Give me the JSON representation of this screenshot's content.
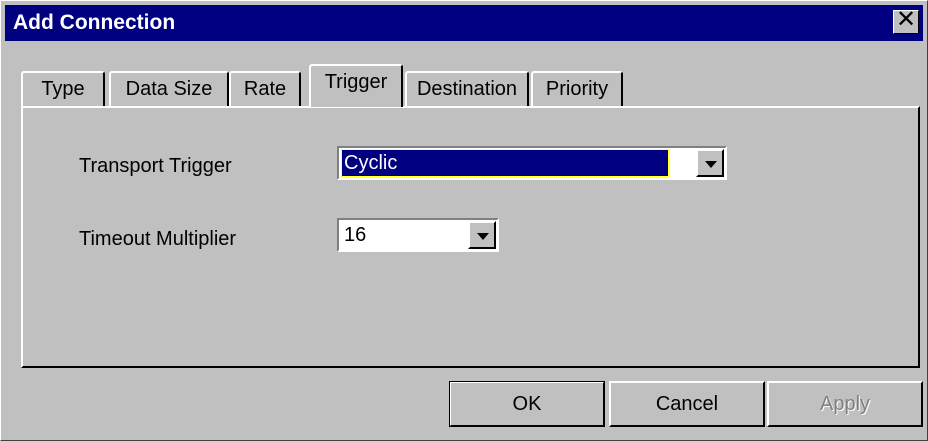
{
  "window": {
    "title": "Add Connection",
    "close_glyph": "✕"
  },
  "tabs": [
    {
      "label": "Type",
      "active": false
    },
    {
      "label": "Data Size",
      "active": false
    },
    {
      "label": "Rate",
      "active": false
    },
    {
      "label": "Trigger",
      "active": true
    },
    {
      "label": "Destination",
      "active": false
    },
    {
      "label": "Priority",
      "active": false
    }
  ],
  "trigger": {
    "transport_label": "Transport Trigger",
    "transport_value": "Cyclic",
    "timeout_label": "Timeout Multiplier",
    "timeout_value": "16"
  },
  "buttons": {
    "ok": "OK",
    "cancel": "Cancel",
    "apply": "Apply"
  },
  "colors": {
    "titlebar": "#000080",
    "face": "#c0c0c0",
    "selection": "#000080"
  },
  "icons": {
    "close": "close-icon",
    "dropdown": "chevron-down-icon"
  }
}
